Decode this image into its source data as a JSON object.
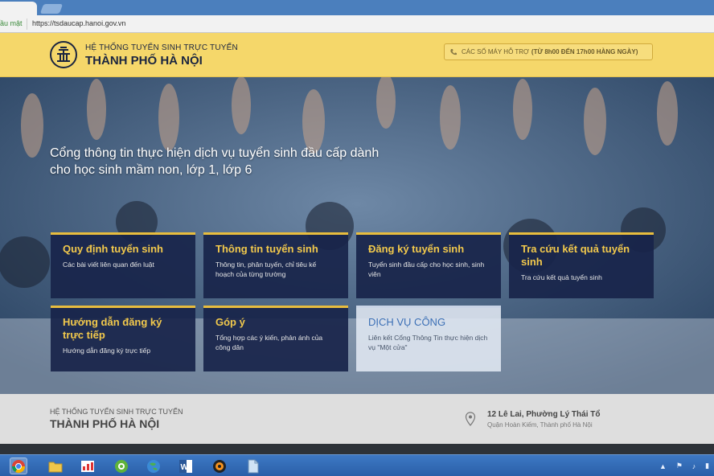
{
  "browser": {
    "address_prefix": "ầu mật",
    "url": "https://tsdaucap.hanoi.gov.vn"
  },
  "header": {
    "subtitle": "HỆ THỐNG TUYỂN SINH TRỰC TUYẾN",
    "title": "THÀNH PHỐ HÀ NỘI",
    "support_label": "CÁC SỐ MÁY HỖ TRỢ",
    "support_detail": "(TỪ 8h00 ĐẾN 17h00 HÀNG NGÀY)"
  },
  "hero": {
    "text": "Cổng thông tin thực hiện dịch vụ tuyển sinh đầu cấp dành cho học sinh mầm non, lớp 1, lớp 6"
  },
  "cards": [
    {
      "title": "Quy định tuyển sinh",
      "desc": "Các bài viết liên quan đến luật"
    },
    {
      "title": "Thông tin tuyển sinh",
      "desc": "Thông tin, phân tuyến, chỉ tiêu kế hoạch của từng trường"
    },
    {
      "title": "Đăng ký tuyển sinh",
      "desc": "Tuyển sinh đầu cấp cho học sinh, sinh viên"
    },
    {
      "title": "Tra cứu kết quả tuyển sinh",
      "desc": "Tra cứu kết quả tuyển sinh"
    },
    {
      "title": "Hướng dẫn đăng ký trực tiếp",
      "desc": "Hướng dẫn đăng ký trực tiếp"
    },
    {
      "title": "Góp ý",
      "desc": "Tổng hợp các ý kiến, phản ánh của công dân"
    },
    {
      "title": "DỊCH VỤ CÔNG",
      "desc": "Liên kết Cổng Thông Tin thực hiện dịch vụ \"Một cửa\""
    }
  ],
  "footer": {
    "subtitle": "HỆ THỐNG TUYỂN SINH TRỰC TUYẾN",
    "title": "THÀNH PHỐ HÀ NỘI",
    "address_line1": "12 Lê Lai, Phường Lý Thái Tổ",
    "address_line2": "Quận Hoàn Kiếm, Thành phố Hà Nội"
  },
  "colors": {
    "header_bg": "#f5d76a",
    "card_bg": "#18244a",
    "card_title": "#f2c94c",
    "accent": "#e8bd3e"
  },
  "taskbar_icons": [
    "chrome-icon",
    "folder-icon",
    "chart-app-icon",
    "green-circle-app-icon",
    "globe-app-icon",
    "word-icon",
    "media-app-icon",
    "file-app-icon"
  ]
}
